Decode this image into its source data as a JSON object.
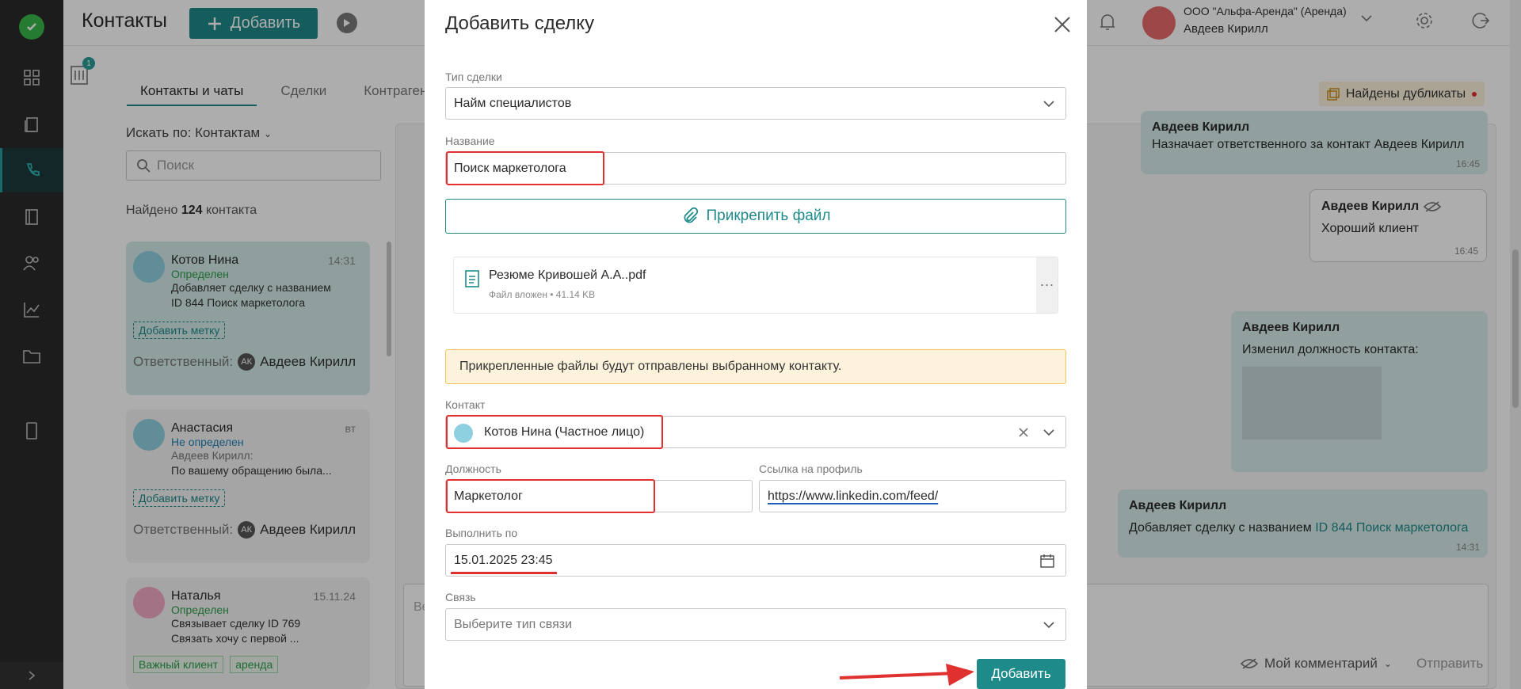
{
  "header": {
    "title": "Контакты",
    "add_label": "Добавить",
    "company": "ООО \"Альфа-Аренда\" (Аренда)",
    "user": "Авдеев Кирилл",
    "filter_badge": "1"
  },
  "tabs": [
    "Контакты и чаты",
    "Сделки",
    "Контрагенты"
  ],
  "search": {
    "by_label": "Искать по: Контактам",
    "placeholder": "Поиск",
    "found_prefix": "Найдено",
    "found_count": "124",
    "found_suffix": "контакта"
  },
  "contacts": [
    {
      "name": "Котов Нина",
      "time": "14:31",
      "status": "Определен",
      "line1": "Добавляет сделку с названием",
      "line2": "ID 844 Поиск маркетолога",
      "tag": "Добавить метку",
      "resp_label": "Ответственный:",
      "resp_initials": "АК",
      "resp_name": "Авдеев Кирилл"
    },
    {
      "name": "Анастасия",
      "time": "вт",
      "status": "Не определен",
      "line1": "Авдеев Кирилл:",
      "line2": "По вашему обращению была...",
      "tag": "Добавить метку",
      "resp_label": "Ответственный:",
      "resp_initials": "АК",
      "resp_name": "Авдеев Кирилл"
    },
    {
      "name": "Наталья",
      "time": "15.11.24",
      "status": "Определен",
      "line1": "Связывает сделку ID 769",
      "line2": "Связать хочу с первой ...",
      "tag1": "Важный клиент",
      "tag2": "аренда"
    }
  ],
  "duplicates": "Найдены дубликаты",
  "chat": {
    "m1_author": "Авдеев Кирилл",
    "m1_text": "Назначает ответственного за контакт Авдеев Кирилл",
    "m1_time": "16:45",
    "m2_author": "Авдеев Кирилл",
    "m2_text": "Хороший клиент",
    "m2_time": "16:45",
    "m3_author": "Авдеев Кирилл",
    "m3_text": "Изменил должность контакта:",
    "m4_author": "Авдеев Кирилл",
    "m4_text": "Добавляет сделку с названием",
    "m4_link": "ID 844 Поиск маркетолога",
    "m4_time": "14:31",
    "input_placeholder": "Ве",
    "comment_label": "Мой комментарий",
    "send_label": "Отправить"
  },
  "modal": {
    "title": "Добавить сделку",
    "deal_type_label": "Тип сделки",
    "deal_type_value": "Найм специалистов",
    "name_label": "Название",
    "name_value": "Поиск маркетолога",
    "attach_label": "Прикрепить файл",
    "file_name": "Резюме Кривошей А.А..pdf",
    "file_meta": "Файл вложен • 41.14 KB",
    "warning": "Прикрепленные файлы будут отправлены выбранному контакту.",
    "contact_label": "Контакт",
    "contact_value": "Котов Нина (Частное лицо)",
    "position_label": "Должность",
    "position_value": "Маркетолог",
    "profile_label": "Ссылка на профиль",
    "profile_value": "https://www.linkedin.com/feed/",
    "due_label": "Выполнить по",
    "due_value": "15.01.2025 23:45",
    "link_label": "Связь",
    "link_placeholder": "Выберите тип связи",
    "submit_label": "Добавить"
  },
  "colors": {
    "accent": "#1f8a8a",
    "highlight": "#e03030",
    "rail": "#2a2a2a",
    "warning_bg": "#fdf2dc"
  }
}
